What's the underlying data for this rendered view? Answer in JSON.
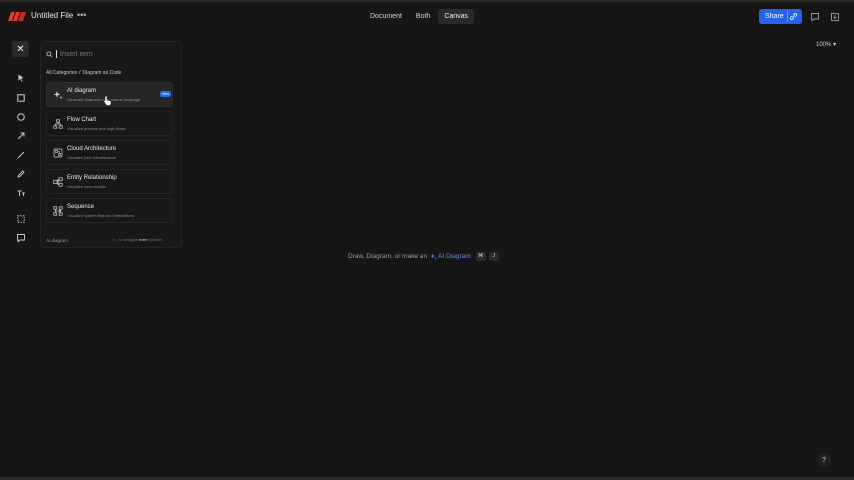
{
  "header": {
    "file_title": "Untitled File",
    "more_icon": "dots-horizontal-icon",
    "views": [
      {
        "label": "Document"
      },
      {
        "label": "Both"
      },
      {
        "label": "Canvas"
      }
    ],
    "active_view": "Canvas",
    "share_label": "Share",
    "accent_color": "#2563eb"
  },
  "insert_panel": {
    "search_placeholder": "Insert item",
    "breadcrumb": {
      "root": "All Categories",
      "separator": "/",
      "current": "Diagram as Code"
    },
    "items": [
      {
        "name": "AI diagram",
        "desc": "Generate diagrams with natural language",
        "badge": "New",
        "icon": "sparkle-icon"
      },
      {
        "name": "Flow Chart",
        "desc": "Visualize process and logic flows",
        "icon": "flowchart-icon"
      },
      {
        "name": "Cloud Architecture",
        "desc": "Visualize your infrastructure",
        "icon": "cloud-architecture-icon"
      },
      {
        "name": "Entity Relationship",
        "desc": "Visualize data models",
        "icon": "entity-relationship-icon"
      },
      {
        "name": "Sequence",
        "desc": "Visualize system flow and interactions",
        "icon": "sequence-icon"
      }
    ],
    "footer_selected": "AI diagram",
    "footer_hint": {
      "keys": "↑ ↓",
      "navigate": "to navigate",
      "enter": "enter",
      "insert": "to insert"
    }
  },
  "canvas": {
    "zoom": "100%",
    "hint_text": "Draw, Diagram, or make an",
    "hint_link": "AI Diagram",
    "shortcut_mod": "⌘",
    "shortcut_key": "J",
    "help_label": "?"
  }
}
